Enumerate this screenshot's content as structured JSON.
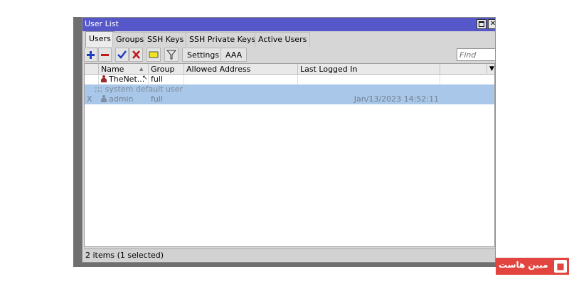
{
  "window": {
    "title": "User List",
    "restore_icon": "restore-icon",
    "close_glyph": "✕"
  },
  "tabs": [
    {
      "label": "Users",
      "active": true
    },
    {
      "label": "Groups"
    },
    {
      "label": "SSH Keys"
    },
    {
      "label": "SSH Private Keys"
    },
    {
      "label": "Active Users"
    }
  ],
  "toolbar": {
    "icons": [
      "add-icon",
      "remove-icon",
      "enable-icon",
      "disable-icon",
      "comment-icon",
      "filter-icon"
    ],
    "settings_label": "Settings",
    "aaa_label": "AAA",
    "find_placeholder": "Find"
  },
  "table": {
    "columns": [
      "Name",
      "Group",
      "Allowed Address",
      "Last Logged In"
    ],
    "sort_indicator": "▲",
    "menu_indicator": "▼",
    "rows": [
      {
        "flag": "",
        "name": "TheNet...",
        "group": "full",
        "allowed_address": "",
        "last_logged_in": "",
        "selected": false,
        "icon_color": "#9b2b2b"
      },
      {
        "comment": ";;; system default user",
        "flag": "X",
        "name": "admin",
        "group": "full",
        "allowed_address": "",
        "last_logged_in": "Jan/13/2023 14:52:11",
        "selected": true,
        "disabled": true,
        "icon_color": "#8090a2"
      }
    ]
  },
  "status": {
    "text": "2 items (1 selected)"
  },
  "watermark": {
    "text": "مبین هاست"
  },
  "colors": {
    "titlebar": "#5658c9",
    "selection": "#a9c7e8",
    "add": "#1e3fbf",
    "remove": "#c21a1a",
    "logo": "#e2453f"
  }
}
